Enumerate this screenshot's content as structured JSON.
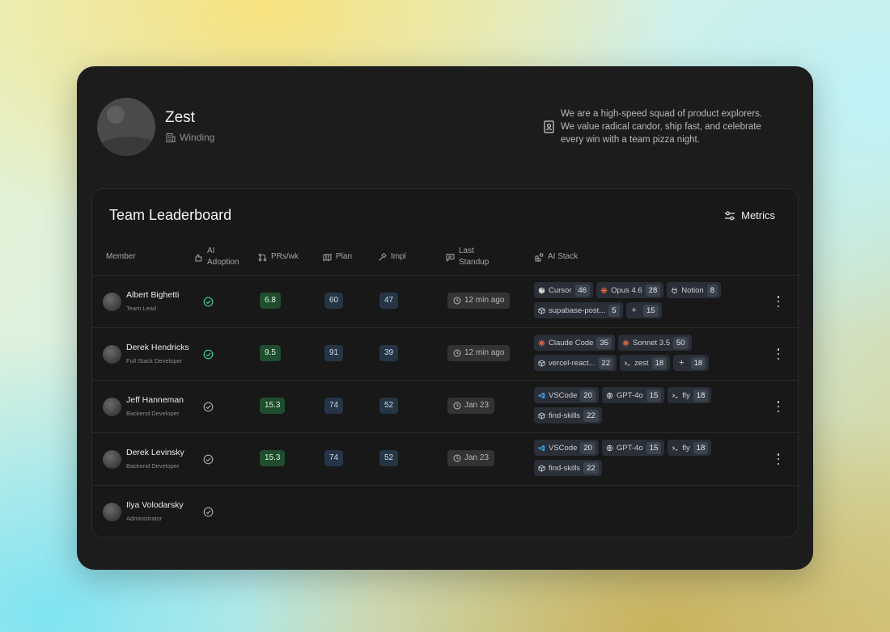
{
  "team": {
    "name": "Zest",
    "org": "Winding",
    "bio": "We are a high-speed squad of product explorers. We value radical candor, ship fast, and celebrate every win with a team pizza night."
  },
  "panel": {
    "title": "Team Leaderboard",
    "metrics_label": "Metrics"
  },
  "columns": {
    "member": "Member",
    "ai_adoption_line1": "AI",
    "ai_adoption_line2": "Adoption",
    "prs": "PRs/wk",
    "plan": "Plan",
    "impl": "Impl",
    "standup_line1": "Last",
    "standup_line2": "Standup",
    "ai_stack": "AI Stack"
  },
  "rows": [
    {
      "name": "Albert Bighetti",
      "role": "Team Lead",
      "adoption": "active",
      "prs": "6.8",
      "plan": "60",
      "impl": "47",
      "standup": "12 min ago",
      "stack": [
        {
          "icon": "cursor-icon",
          "label": "Cursor",
          "count": "46"
        },
        {
          "icon": "claude-icon",
          "label": "Opus 4.6",
          "count": "28"
        },
        {
          "icon": "notion-icon",
          "label": "Notion",
          "count": "8"
        },
        {
          "icon": "package-icon",
          "label": "supabase-post...",
          "count": "5"
        },
        {
          "icon": "plus-icon",
          "label": "+",
          "count": "15"
        }
      ]
    },
    {
      "name": "Derek Hendricks",
      "role": "Full Stack Developer",
      "adoption": "active",
      "prs": "9.5",
      "plan": "91",
      "impl": "39",
      "standup": "12 min ago",
      "stack": [
        {
          "icon": "claude-icon",
          "label": "Claude Code",
          "count": "35"
        },
        {
          "icon": "claude-icon",
          "label": "Sonnet 3.5",
          "count": "50"
        },
        {
          "icon": "package-icon",
          "label": "vercel-react...",
          "count": "22"
        },
        {
          "icon": "terminal-icon",
          "label": "zest",
          "count": "18"
        },
        {
          "icon": "plus-icon",
          "label": "+",
          "count": "18"
        }
      ]
    },
    {
      "name": "Jeff Hanneman",
      "role": "Backend Developer",
      "adoption": "inactive",
      "prs": "15.3",
      "plan": "74",
      "impl": "52",
      "standup": "Jan 23",
      "stack": [
        {
          "icon": "vscode-icon",
          "label": "VSCode",
          "count": "20"
        },
        {
          "icon": "openai-icon",
          "label": "GPT-4o",
          "count": "15"
        },
        {
          "icon": "terminal-icon",
          "label": "fly",
          "count": "18"
        },
        {
          "icon": "package-icon",
          "label": "find-skills",
          "count": "22"
        }
      ]
    },
    {
      "name": "Derek Levinsky",
      "role": "Backend Developer",
      "adoption": "inactive",
      "prs": "15.3",
      "plan": "74",
      "impl": "52",
      "standup": "Jan 23",
      "stack": [
        {
          "icon": "vscode-icon",
          "label": "VSCode",
          "count": "20"
        },
        {
          "icon": "openai-icon",
          "label": "GPT-4o",
          "count": "15"
        },
        {
          "icon": "terminal-icon",
          "label": "fly",
          "count": "18"
        },
        {
          "icon": "package-icon",
          "label": "find-skills",
          "count": "22"
        }
      ]
    },
    {
      "name": "Ilya Volodarsky",
      "role": "Administrator",
      "adoption": "inactive",
      "prs": "",
      "plan": "",
      "impl": "",
      "standup": "",
      "stack": []
    }
  ],
  "colors": {
    "active_check": "#3ecf8e",
    "inactive_check": "#a8a8aa",
    "claude": "#e0673b",
    "vscode": "#2f9fe8"
  }
}
